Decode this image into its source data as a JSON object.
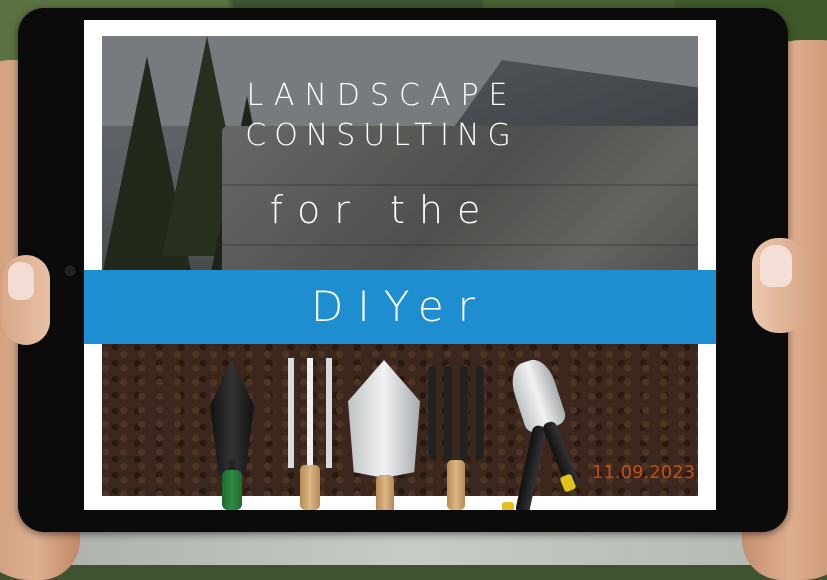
{
  "headline": {
    "line1": "LANDSCAPE",
    "line2": "CONSULTING",
    "line3": "for the",
    "banner": "DIYer"
  },
  "date_stamp": "11.09.2023",
  "colors": {
    "banner_blue": "#1f8ed1",
    "date_stamp": "#d8561a",
    "text": "#ffffff"
  },
  "tools": [
    "black-trowel-icon",
    "hand-cultivator-icon",
    "silver-trowel-icon",
    "hand-fork-icon",
    "pruning-shears-icon"
  ]
}
